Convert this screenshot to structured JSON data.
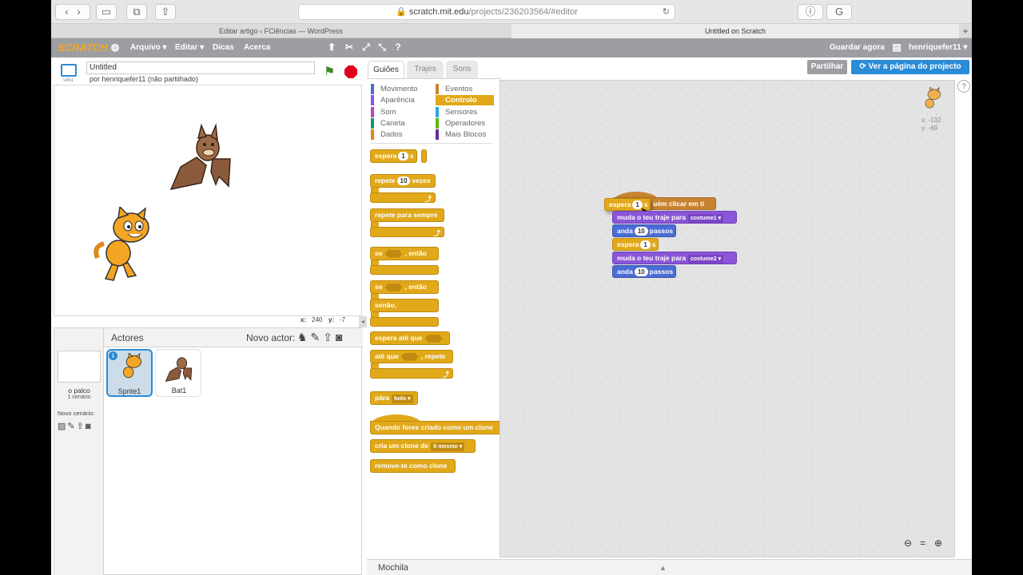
{
  "browser": {
    "url_host": "scratch.mit.edu",
    "url_path": "/projects/236203564/#editor",
    "tabs": [
      {
        "title": "Editar artigo ‹ FCiências — WordPress"
      },
      {
        "title": "Untitled on Scratch"
      }
    ]
  },
  "menu": {
    "logo": "SCRATCH",
    "items": [
      "Arquivo ▾",
      "Editar ▾",
      "Dicas",
      "Acerca"
    ],
    "save": "Guardar agora",
    "user": "henriquefer11 ▾"
  },
  "stage": {
    "title": "Untitled",
    "author": "por henriquefer11 (não partilhado)",
    "version": "v461",
    "x_label": "x:",
    "x_value": "240",
    "y_label": "y:",
    "y_value": "-7"
  },
  "sprites": {
    "header": "Actores",
    "new_actor": "Novo actor:",
    "stage_label": "o palco",
    "stage_count": "1 cenário",
    "new_scene": "Novo cenário:",
    "items": [
      {
        "name": "Sprite1"
      },
      {
        "name": "Bat1"
      }
    ]
  },
  "tabs": {
    "scripts": "Guiões",
    "costumes": "Trajes",
    "sounds": "Sons"
  },
  "header_buttons": {
    "share": "Partilhar",
    "project_page": "Ver a página do projecto"
  },
  "categories": {
    "left": [
      "Movimento",
      "Aparência",
      "Som",
      "Caneta",
      "Dados"
    ],
    "right": [
      "Eventos",
      "Controlo",
      "Sensores",
      "Operadores",
      "Mais Blocos"
    ],
    "colors": {
      "Movimento": "#4a6cd4",
      "Aparência": "#8a55d7",
      "Som": "#bb42c3",
      "Caneta": "#0e9a6c",
      "Dados": "#ee7d16",
      "Eventos": "#c88330",
      "Controlo": "#e1a91a",
      "Sensores": "#2ca5e2",
      "Operadores": "#5cb712",
      "Mais Blocos": "#632d99"
    },
    "selected": "Controlo"
  },
  "palette": {
    "wait": "espera",
    "wait_val": "1",
    "wait_unit": "s",
    "repeat": "repete",
    "repeat_val": "10",
    "repeat_unit": "vezes",
    "forever": "repete para sempre",
    "if": "se",
    "then": ", então",
    "else": "senão,",
    "wait_until": "espera até que",
    "until": "até que",
    "repeat2": ", repete",
    "stop": "pára",
    "stop_opt": "tudo",
    "clone_hat": "Quando fores criado como um clone",
    "create_clone": "cria um clone de",
    "clone_opt": "ti mesmo",
    "delete_clone": "remove-te como clone"
  },
  "script": {
    "hat": "Quando alguém clicar em ti",
    "hat_visible": "uém clicar em ti",
    "dragging": "espera",
    "dragging_val": "1",
    "dragging_unit": "s",
    "costume_block": "muda o teu traje para",
    "costume1": "costume1",
    "costume2": "costume2",
    "move": "anda",
    "move_val": "10",
    "move_unit": "passos",
    "wait": "espera",
    "wait_val": "1",
    "wait_unit": "s"
  },
  "sprite_info": {
    "x": "x: -132",
    "y": "y: -69"
  },
  "backpack": "Mochila"
}
